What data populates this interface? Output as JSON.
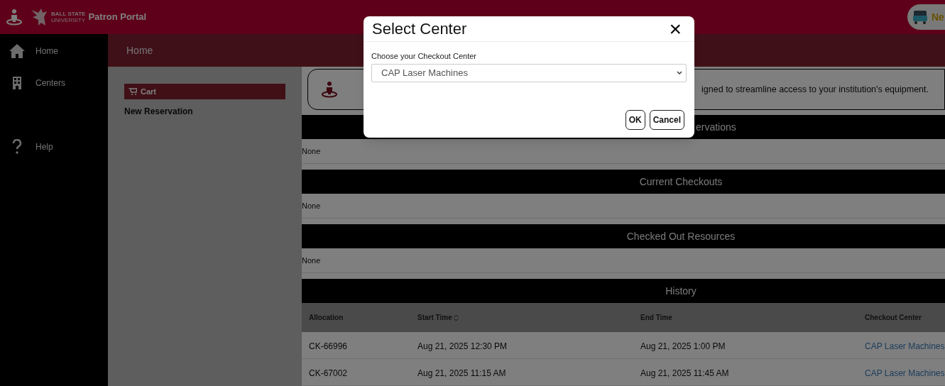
{
  "header": {
    "brand_line_1": "BALL STATE",
    "brand_line_2": "UNIVERSITY",
    "title": "Patron Portal",
    "user_button": "Ne"
  },
  "sidebar": {
    "items": [
      {
        "label": "Home"
      },
      {
        "label": "Centers"
      },
      {
        "label": "Help"
      }
    ]
  },
  "breadcrumb": "Home",
  "left_panel": {
    "cart": "Cart",
    "link": "New Reservation"
  },
  "banner": {
    "text": "igned to streamline access to your institution's equipment."
  },
  "sections": [
    {
      "title": "ervations",
      "body": "None"
    },
    {
      "title": "Current Checkouts",
      "body": "None"
    },
    {
      "title": "Checked Out Resources",
      "body": "None"
    }
  ],
  "history": {
    "title": "History",
    "columns": [
      {
        "label": "Allocation",
        "sortable": false
      },
      {
        "label": "Start Time",
        "sortable": true
      },
      {
        "label": "End Time",
        "sortable": false
      },
      {
        "label": "Checkout Center",
        "sortable": false
      }
    ],
    "rows": [
      [
        "CK-66996",
        "Aug 21, 2025 12:30 PM",
        "Aug 21, 2025 1:00 PM",
        "CAP Laser Machines"
      ],
      [
        "CK-67002",
        "Aug 21, 2025 11:15 AM",
        "Aug 21, 2025 11:45 AM",
        "CAP Laser Machines"
      ]
    ]
  },
  "modal": {
    "title": "Select Center",
    "close": "×",
    "label": "Choose your Checkout Center",
    "value": "CAP Laser Machines",
    "buttons": [
      "OK",
      "Cancel"
    ]
  }
}
